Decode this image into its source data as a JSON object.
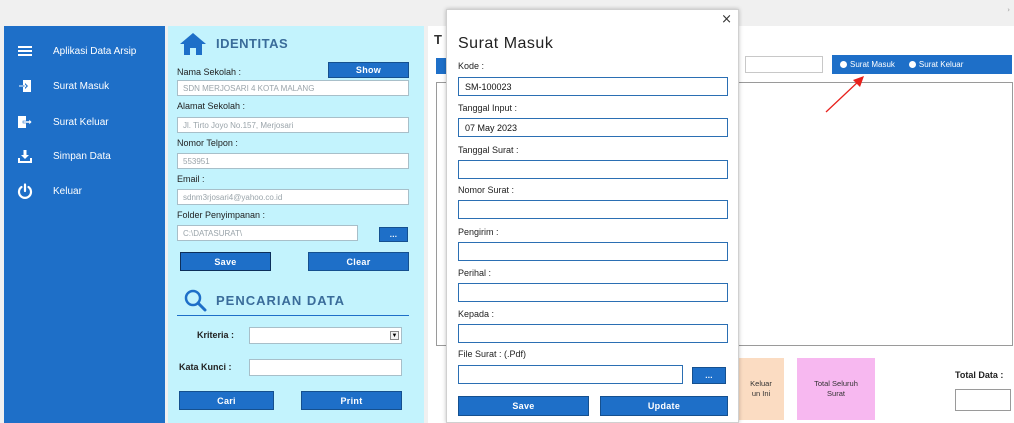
{
  "sidebar": {
    "items": [
      {
        "label": "Aplikasi Data Arsip",
        "icon": "menu-icon"
      },
      {
        "label": "Surat Masuk",
        "icon": "inbox-arrow-icon"
      },
      {
        "label": "Surat Keluar",
        "icon": "outbox-arrow-icon"
      },
      {
        "label": "Simpan Data",
        "icon": "download-icon"
      },
      {
        "label": "Keluar",
        "icon": "power-icon"
      }
    ]
  },
  "identity": {
    "title": "IDENTITAS",
    "nama_label": "Nama Sekolah :",
    "nama_value": "SDN MERJOSARI 4 KOTA MALANG",
    "show_label": "Show",
    "alamat_label": "Alamat Sekolah :",
    "alamat_value": "Jl. Tirto Joyo No.157, Merjosari",
    "telpon_label": "Nomor Telpon :",
    "telpon_value": "553951",
    "email_label": "Email :",
    "email_value": "sdnm3rjosari4@yahoo.co.id",
    "folder_label": "Folder Penyimpanan :",
    "folder_value": "C:\\DATASURAT\\",
    "browse_label": "...",
    "save_label": "Save",
    "clear_label": "Clear"
  },
  "search": {
    "title": "PENCARIAN DATA",
    "kriteria_label": "Kriteria :",
    "kata_kunci_label": "Kata Kunci :",
    "cari_label": "Cari",
    "print_label": "Print"
  },
  "main": {
    "title_fragment": "T",
    "radio_masuk": "Surat Masuk",
    "radio_keluar": "Surat Keluar",
    "card_keluar_line1": "Keluar",
    "card_keluar_line2": "un Ini",
    "card_total_line1": "Total Seluruh",
    "card_total_line2": "Surat",
    "total_data_label": "Total Data :"
  },
  "dialog": {
    "close_glyph": "×",
    "title": "Surat Masuk",
    "kode_label": "Kode :",
    "kode_value": "SM-100023",
    "tanggal_input_label": "Tanggal Input :",
    "tanggal_input_value": "07 May 2023",
    "tanggal_surat_label": "Tanggal Surat :",
    "nomor_surat_label": "Nomor Surat :",
    "pengirim_label": "Pengirim :",
    "perihal_label": "Perihal :",
    "kepada_label": "Kepada :",
    "file_label": "File Surat : (.Pdf)",
    "browse_label": "...",
    "save_label": "Save",
    "update_label": "Update"
  },
  "colors": {
    "accent": "#1e6fc8",
    "panel_bg": "#c3f3fd",
    "card_peach": "#fbdcc2",
    "card_pink": "#f7b8f0",
    "annotation_arrow": "#e8201c"
  }
}
